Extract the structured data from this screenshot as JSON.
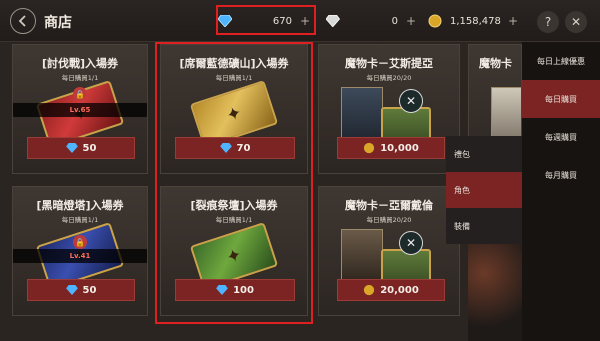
{
  "header": {
    "title": "商店"
  },
  "currency": {
    "diamond": "670",
    "silver": "0",
    "gold": "1,158,478",
    "plus": "+"
  },
  "buttons": {
    "help": "?",
    "close": "✕"
  },
  "cards": [
    {
      "title": "[討伐戰]入場券",
      "limit": "每日購買1/1",
      "price": "50",
      "currency_icon": "diamond-icon",
      "ticket_color": "red",
      "locked": true,
      "lock_text": "Lv.65"
    },
    {
      "title": "[席爾藍德礦山]入場券",
      "limit": "每日購買1/1",
      "price": "70",
      "currency_icon": "diamond-icon",
      "ticket_color": "gold",
      "locked": false
    },
    {
      "title": "魔物卡－艾斯提亞",
      "limit": "每日購買20/20",
      "price": "10,000",
      "currency_icon": "gold-coin-icon"
    },
    {
      "title": "魔物卡",
      "limit": "",
      "price": "",
      "currency_icon": ""
    },
    {
      "title": "[黑暗燈塔]入場券",
      "limit": "每日購買1/1",
      "price": "50",
      "currency_icon": "diamond-icon",
      "ticket_color": "navy",
      "locked": true,
      "lock_text": "Lv.41"
    },
    {
      "title": "[裂痕祭壇]入場券",
      "limit": "每日購買1/1",
      "price": "100",
      "currency_icon": "diamond-icon",
      "ticket_color": "green",
      "locked": false
    },
    {
      "title": "魔物卡－亞爾戴倫",
      "limit": "每日購買20/20",
      "price": "20,000",
      "currency_icon": "gold-coin-icon"
    }
  ],
  "subtabs": [
    {
      "label": "禮包",
      "active": false
    },
    {
      "label": "角色",
      "active": true
    },
    {
      "label": "裝備",
      "active": false
    }
  ],
  "tabs": [
    {
      "label": "每日上線優惠",
      "active": false
    },
    {
      "label": "每日購買",
      "active": true
    },
    {
      "label": "每週購買",
      "active": false
    },
    {
      "label": "每月購買",
      "active": false
    }
  ],
  "colors": {
    "accent_red": "#7c2424",
    "highlight": "#e02020",
    "gold": "#c9a24a"
  }
}
